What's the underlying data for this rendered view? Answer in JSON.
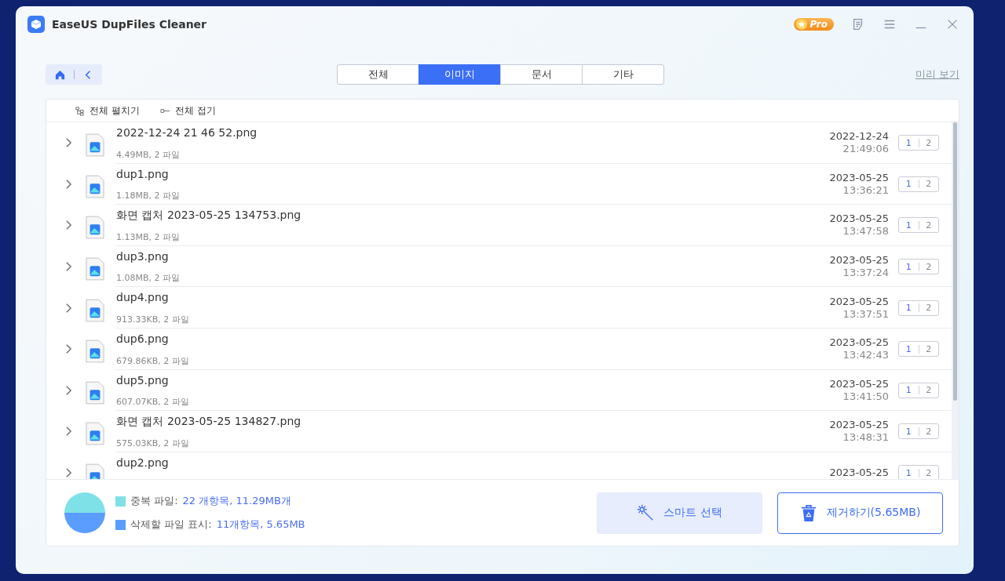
{
  "window": {
    "title": "EaseUS DupFiles Cleaner",
    "pro_badge": "Pro"
  },
  "tabs": [
    {
      "label": "전체",
      "selected": false
    },
    {
      "label": "이미지",
      "selected": true
    },
    {
      "label": "문서",
      "selected": false
    },
    {
      "label": "기타",
      "selected": false
    }
  ],
  "preview_link": "미리 보기",
  "toolbar": {
    "expand_all": "전체 펼치기",
    "collapse_all": "전체 접기"
  },
  "rows": [
    {
      "name": "2022-12-24 21 46 52.png",
      "size": "4.49MB, 2 파일",
      "date": "2022-12-24",
      "time": "21:49:06",
      "badge": [
        "1",
        "2"
      ]
    },
    {
      "name": "dup1.png",
      "size": "1.18MB, 2 파일",
      "date": "2023-05-25",
      "time": "13:36:21",
      "badge": [
        "1",
        "2"
      ]
    },
    {
      "name": "화면 캡처 2023-05-25 134753.png",
      "size": "1.13MB, 2 파일",
      "date": "2023-05-25",
      "time": "13:47:58",
      "badge": [
        "1",
        "2"
      ]
    },
    {
      "name": "dup3.png",
      "size": "1.08MB, 2 파일",
      "date": "2023-05-25",
      "time": "13:37:24",
      "badge": [
        "1",
        "2"
      ]
    },
    {
      "name": "dup4.png",
      "size": "913.33KB, 2 파일",
      "date": "2023-05-25",
      "time": "13:37:51",
      "badge": [
        "1",
        "2"
      ]
    },
    {
      "name": "dup6.png",
      "size": "679.86KB, 2 파일",
      "date": "2023-05-25",
      "time": "13:42:43",
      "badge": [
        "1",
        "2"
      ]
    },
    {
      "name": "dup5.png",
      "size": "607.07KB, 2 파일",
      "date": "2023-05-25",
      "time": "13:41:50",
      "badge": [
        "1",
        "2"
      ]
    },
    {
      "name": "화면 캡처 2023-05-25 134827.png",
      "size": "575.03KB, 2 파일",
      "date": "2023-05-25",
      "time": "13:48:31",
      "badge": [
        "1",
        "2"
      ]
    },
    {
      "name": "dup2.png",
      "date": "2023-05-25",
      "badge": [
        "1",
        "2"
      ]
    }
  ],
  "summary": [
    {
      "label": "중복 파일:",
      "value": "22 개항목, 11.29MB개",
      "color": "#7fe1e8"
    },
    {
      "label": "삭제할 파일 표시:",
      "value": "11개항목, 5.65MB",
      "color": "#5b9dff"
    }
  ],
  "buttons": {
    "smart_select": "스마트 선택",
    "remove": "제거하기(5.65MB)"
  }
}
